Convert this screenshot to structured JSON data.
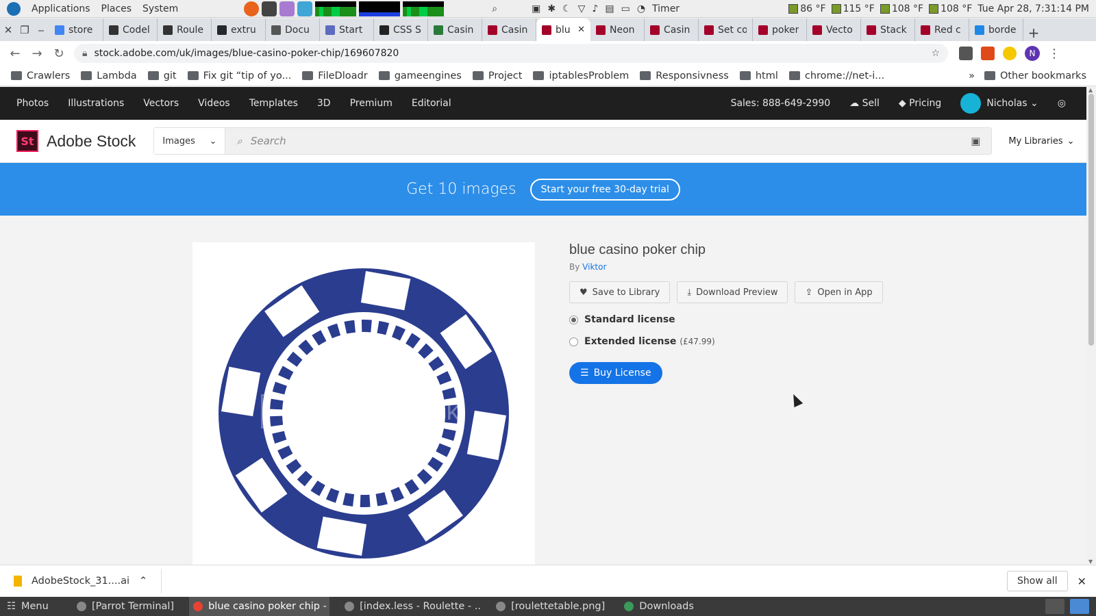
{
  "os_panel": {
    "menus": [
      "Applications",
      "Places",
      "System"
    ],
    "timer_label": "Timer",
    "temps": [
      "86 °F",
      "115 °F",
      "108 °F",
      "108 °F"
    ],
    "clock": "Tue Apr 28, 7:31:14 PM"
  },
  "browser": {
    "tabs": [
      {
        "label": "store",
        "color": "#4285f4"
      },
      {
        "label": "Codel",
        "color": "#333333"
      },
      {
        "label": "Roule",
        "color": "#333333"
      },
      {
        "label": "extru",
        "color": "#24292e"
      },
      {
        "label": "Docu",
        "color": "#555555"
      },
      {
        "label": "Start",
        "color": "#5c6bc0"
      },
      {
        "label": "CSS S",
        "color": "#222222"
      },
      {
        "label": "Casin",
        "color": "#2a7a3a"
      },
      {
        "label": "Casin",
        "color": "#a3002a"
      },
      {
        "label": "blu",
        "color": "#a3002a",
        "active": true
      },
      {
        "label": "Neon",
        "color": "#a3002a"
      },
      {
        "label": "Casin",
        "color": "#a3002a"
      },
      {
        "label": "Set co",
        "color": "#a3002a"
      },
      {
        "label": "poker",
        "color": "#a3002a"
      },
      {
        "label": "Vecto",
        "color": "#a3002a"
      },
      {
        "label": "Stack",
        "color": "#a3002a"
      },
      {
        "label": "Red c",
        "color": "#a3002a"
      },
      {
        "label": "borde",
        "color": "#1e88e5"
      }
    ],
    "url": "stock.adobe.com/uk/images/blue-casino-poker-chip/169607820",
    "profile_initial": "N",
    "bookmarks": [
      {
        "label": "Crawlers"
      },
      {
        "label": "Lambda"
      },
      {
        "label": "git"
      },
      {
        "label": "Fix git “tip of yo..."
      },
      {
        "label": "FileDloadr"
      },
      {
        "label": "gameengines"
      },
      {
        "label": "Project"
      },
      {
        "label": "iptablesProblem"
      },
      {
        "label": "Responsivness"
      },
      {
        "label": "html"
      },
      {
        "label": "chrome://net-i..."
      }
    ],
    "more_bookmarks": "»",
    "other_bookmarks": "Other bookmarks"
  },
  "stock": {
    "nav": [
      "Photos",
      "Illustrations",
      "Vectors",
      "Videos",
      "Templates",
      "3D",
      "Premium",
      "Editorial"
    ],
    "sales": "Sales: 888-649-2990",
    "sell": "Sell",
    "pricing": "Pricing",
    "user": "Nicholas",
    "logo_mark": "St",
    "brand": "Adobe Stock",
    "filter": "Images",
    "search_placeholder": "Search",
    "my_libraries": "My Libraries",
    "promo_text": "Get 10 images",
    "promo_button": "Start your free 30-day trial",
    "watermark": "Adobe Stock",
    "chip_color": "#2b3d8f",
    "title": "blue casino poker chip",
    "by_label": "By",
    "author": "Viktor",
    "save": "Save to Library",
    "download": "Download Preview",
    "open": "Open in App",
    "standard": "Standard license",
    "extended": "Extended license",
    "extended_price": "(£47.99)",
    "buy": "Buy License"
  },
  "downloads": {
    "file": "AdobeStock_31....ai",
    "show_all": "Show all"
  },
  "taskbar": {
    "menu": "Menu",
    "tasks": [
      {
        "label": "[Parrot Terminal]",
        "color": "#888888"
      },
      {
        "label": "blue casino poker chip - ...",
        "color": "#e94235",
        "active": true
      },
      {
        "label": "[index.less - Roulette - ...",
        "color": "#888888"
      },
      {
        "label": "[roulettetable.png]",
        "color": "#888888"
      },
      {
        "label": "Downloads",
        "color": "#3a9a5a"
      }
    ]
  }
}
